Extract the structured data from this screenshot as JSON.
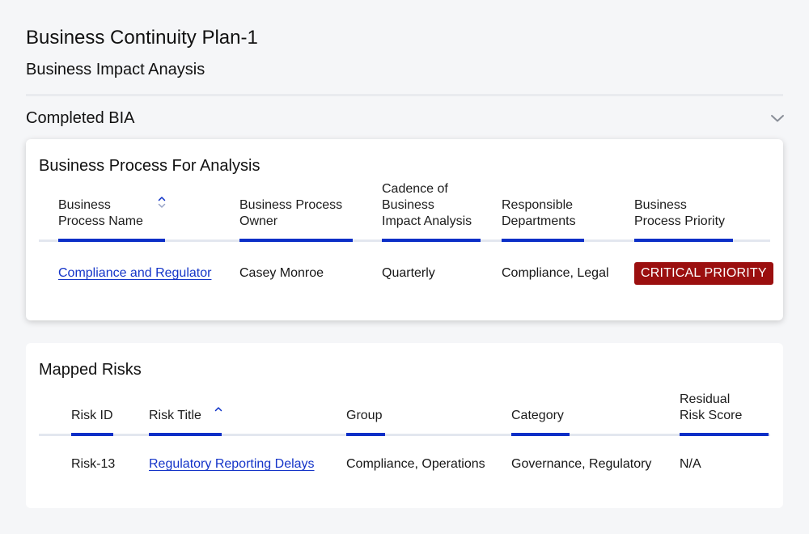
{
  "page": {
    "title": "Business Continuity Plan-1",
    "subtitle": "Business Impact Anaysis"
  },
  "section": {
    "label": "Completed BIA",
    "toggle_icon": "chevron-down-icon"
  },
  "process_card": {
    "title": "Business Process For Analysis",
    "columns": [
      {
        "line1": "Business",
        "line2": "Process Name",
        "line3": ""
      },
      {
        "line1": "Business Process",
        "line2": "Owner",
        "line3": ""
      },
      {
        "line1": "Cadence of",
        "line2": "Business",
        "line3": "Impact Analysis"
      },
      {
        "line1": "Responsible",
        "line2": "Departments",
        "line3": ""
      },
      {
        "line1": "Business",
        "line2": "Process Priority",
        "line3": ""
      }
    ],
    "row": {
      "name": "Compliance and Regulator",
      "owner": "Casey Monroe",
      "cadence": "Quarterly",
      "departments": "Compliance, Legal",
      "priority": "CRITICAL PRIORITY"
    }
  },
  "risks_card": {
    "title": "Mapped Risks",
    "columns": [
      {
        "line1": "Risk ID",
        "line2": ""
      },
      {
        "line1": "Risk Title",
        "line2": ""
      },
      {
        "line1": "Group",
        "line2": ""
      },
      {
        "line1": "Category",
        "line2": ""
      },
      {
        "line1": "Residual",
        "line2": "Risk Score"
      }
    ],
    "row": {
      "id": "Risk-13",
      "title": "Regulatory Reporting Delays",
      "group": "Compliance, Operations",
      "category": "Governance, Regulatory",
      "score": "N/A"
    }
  },
  "colors": {
    "accent": "#0b2fc7",
    "link": "#1434c8",
    "critical": "#9b0f0f"
  }
}
